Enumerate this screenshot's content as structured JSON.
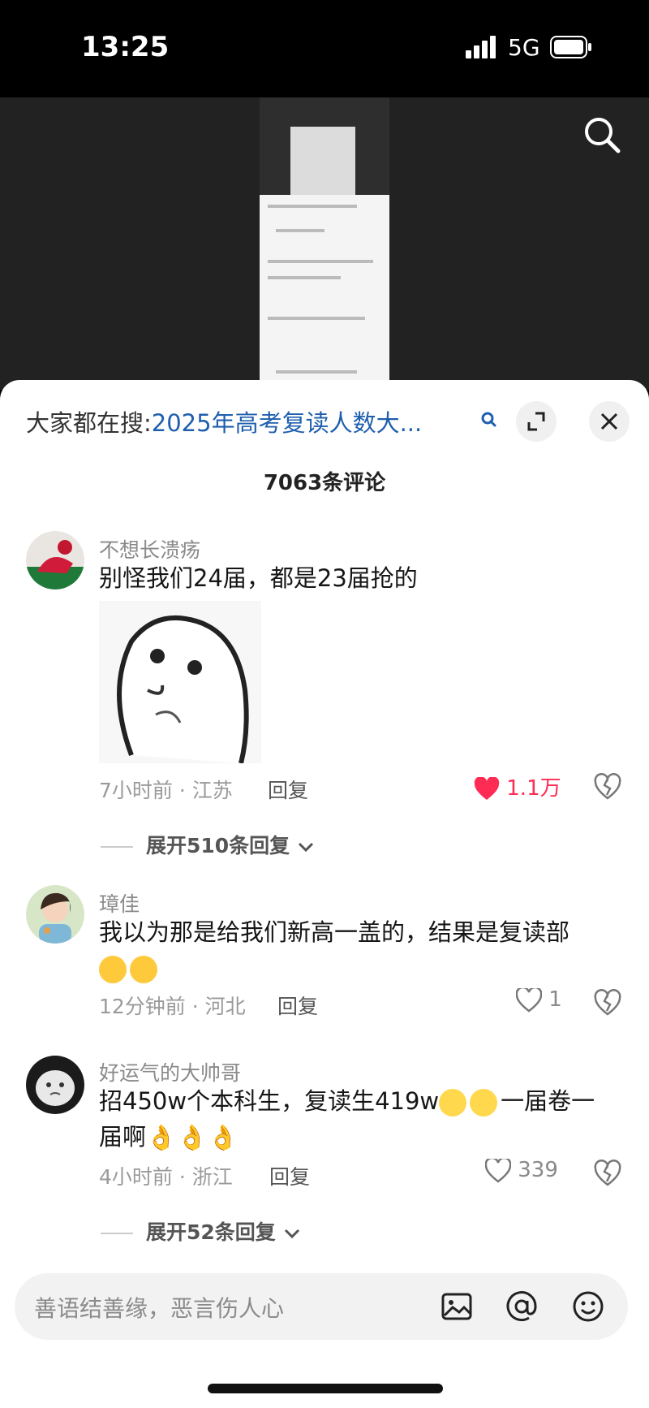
{
  "status": {
    "time": "13:25",
    "network": "5G"
  },
  "hot_search": {
    "prefix": "大家都在搜:",
    "query": "2025年高考复读人数大..."
  },
  "comment_count": "7063条评论",
  "comments": [
    {
      "username": "不想长溃疡",
      "text": "别怪我们24届，都是23届抢的",
      "time_location": "7小时前 · 江苏",
      "reply": "回复",
      "likes": "1.1万",
      "liked": true,
      "expand": "展开510条回复"
    },
    {
      "username": "璋佳",
      "text": "我以为那是给我们新高一盖的，结果是复读部",
      "time_location": "12分钟前 · 河北",
      "reply": "回复",
      "likes": "1",
      "liked": false
    },
    {
      "username": "好运气的大帅哥",
      "text_line1": "招450w个本科生，复读生419w",
      "text_line1_end": "一届卷一",
      "text_line2": "届啊",
      "time_location": "4小时前 · 浙江",
      "reply": "回复",
      "likes": "339",
      "liked": false,
      "expand": "展开52条回复"
    }
  ],
  "input": {
    "placeholder": "善语结善缘，恶言伤人心"
  },
  "colors": {
    "accent_blue": "#1f5fae",
    "like_red": "#fe2c55"
  }
}
